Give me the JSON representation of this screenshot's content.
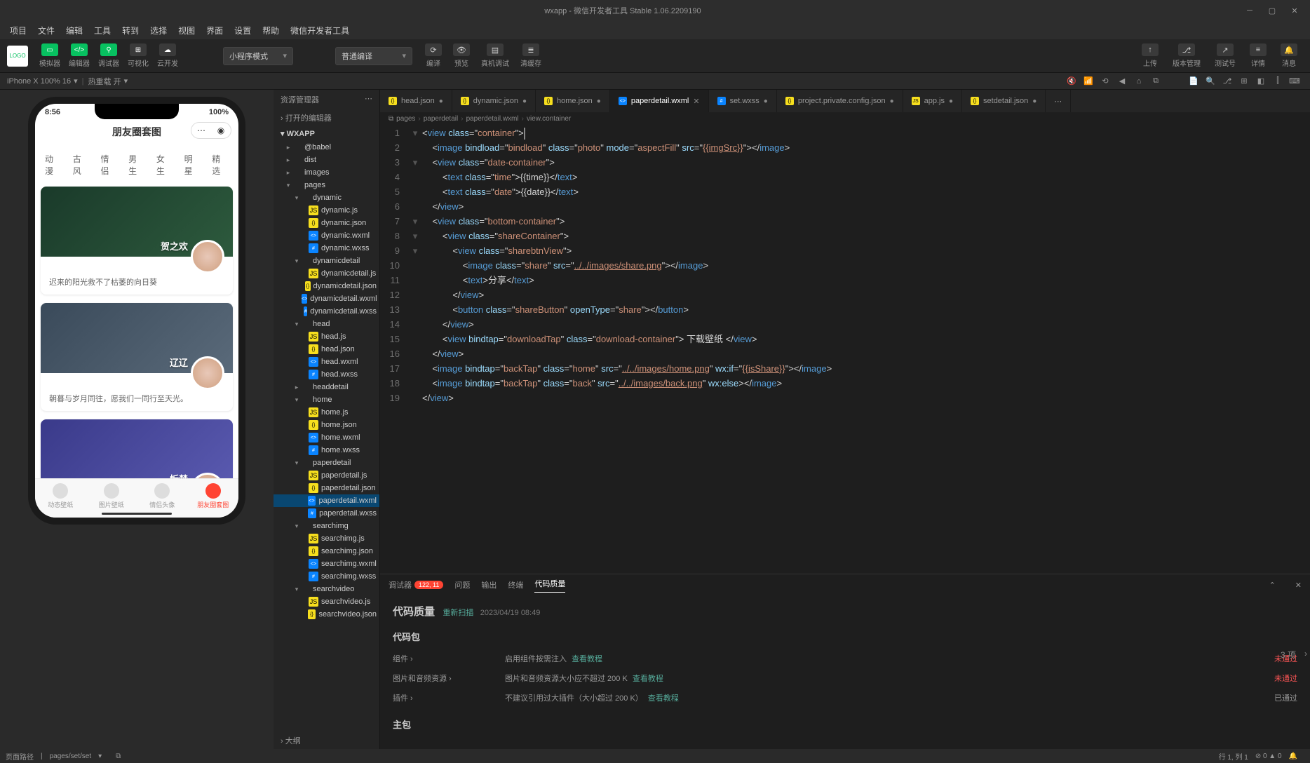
{
  "titlebar": {
    "title": "wxapp - 微信开发者工具 Stable 1.06.2209190"
  },
  "menu": {
    "items": [
      "项目",
      "文件",
      "编辑",
      "工具",
      "转到",
      "选择",
      "视图",
      "界面",
      "设置",
      "帮助",
      "微信开发者工具"
    ]
  },
  "toolbar": {
    "sim": "模拟器",
    "editor": "编辑器",
    "debug": "调试器",
    "visual": "可视化",
    "cloud": "云开发",
    "mode": "小程序模式",
    "compileMode": "普通编译",
    "compile": "编译",
    "preview": "预览",
    "remote": "真机调试",
    "clear": "清缓存",
    "upload": "上传",
    "version": "版本管理",
    "testnum": "测试号",
    "detail": "详情",
    "message": "消息"
  },
  "devicebar": {
    "device": "iPhone X 100% 16",
    "reload": "热重载 开"
  },
  "phone": {
    "time": "8:56",
    "battery": "100%",
    "title": "朋友圈套图",
    "tabs": [
      "动漫",
      "古风",
      "情侣",
      "男生",
      "女生",
      "明星",
      "精选"
    ],
    "card1": {
      "name": "贺之欢",
      "desc": "迟来的阳光救不了枯萎的向日葵"
    },
    "card2": {
      "name": "辽辽",
      "desc": "朝暮与岁月同往，愿我们一同行至天光。"
    },
    "card3": {
      "name": "忻楚"
    },
    "nav": [
      "动态壁纸",
      "图片壁纸",
      "情侣头像",
      "朋友圈套图"
    ]
  },
  "filetree": {
    "header": "资源管理器",
    "openeds": "› 打开的编辑器",
    "outline": "› 大纲",
    "root": "WXAPP",
    "nodes": [
      {
        "indent": 1,
        "name": "@babel",
        "type": "folder"
      },
      {
        "indent": 1,
        "name": "dist",
        "type": "folder"
      },
      {
        "indent": 1,
        "name": "images",
        "type": "folder"
      },
      {
        "indent": 1,
        "name": "pages",
        "type": "folder-open"
      },
      {
        "indent": 2,
        "name": "dynamic",
        "type": "folder-open"
      },
      {
        "indent": 3,
        "name": "dynamic.js",
        "type": "js"
      },
      {
        "indent": 3,
        "name": "dynamic.json",
        "type": "json"
      },
      {
        "indent": 3,
        "name": "dynamic.wxml",
        "type": "wxml"
      },
      {
        "indent": 3,
        "name": "dynamic.wxss",
        "type": "wxss"
      },
      {
        "indent": 2,
        "name": "dynamicdetail",
        "type": "folder-open"
      },
      {
        "indent": 3,
        "name": "dynamicdetail.js",
        "type": "js"
      },
      {
        "indent": 3,
        "name": "dynamicdetail.json",
        "type": "json"
      },
      {
        "indent": 3,
        "name": "dynamicdetail.wxml",
        "type": "wxml"
      },
      {
        "indent": 3,
        "name": "dynamicdetail.wxss",
        "type": "wxss"
      },
      {
        "indent": 2,
        "name": "head",
        "type": "folder-open"
      },
      {
        "indent": 3,
        "name": "head.js",
        "type": "js"
      },
      {
        "indent": 3,
        "name": "head.json",
        "type": "json"
      },
      {
        "indent": 3,
        "name": "head.wxml",
        "type": "wxml"
      },
      {
        "indent": 3,
        "name": "head.wxss",
        "type": "wxss"
      },
      {
        "indent": 2,
        "name": "headdetail",
        "type": "folder"
      },
      {
        "indent": 2,
        "name": "home",
        "type": "folder-open"
      },
      {
        "indent": 3,
        "name": "home.js",
        "type": "js"
      },
      {
        "indent": 3,
        "name": "home.json",
        "type": "json"
      },
      {
        "indent": 3,
        "name": "home.wxml",
        "type": "wxml"
      },
      {
        "indent": 3,
        "name": "home.wxss",
        "type": "wxss"
      },
      {
        "indent": 2,
        "name": "paperdetail",
        "type": "folder-open"
      },
      {
        "indent": 3,
        "name": "paperdetail.js",
        "type": "js"
      },
      {
        "indent": 3,
        "name": "paperdetail.json",
        "type": "json"
      },
      {
        "indent": 3,
        "name": "paperdetail.wxml",
        "type": "wxml",
        "sel": true
      },
      {
        "indent": 3,
        "name": "paperdetail.wxss",
        "type": "wxss"
      },
      {
        "indent": 2,
        "name": "searchimg",
        "type": "folder-open"
      },
      {
        "indent": 3,
        "name": "searchimg.js",
        "type": "js"
      },
      {
        "indent": 3,
        "name": "searchimg.json",
        "type": "json"
      },
      {
        "indent": 3,
        "name": "searchimg.wxml",
        "type": "wxml"
      },
      {
        "indent": 3,
        "name": "searchimg.wxss",
        "type": "wxss"
      },
      {
        "indent": 2,
        "name": "searchvideo",
        "type": "folder-open"
      },
      {
        "indent": 3,
        "name": "searchvideo.js",
        "type": "js"
      },
      {
        "indent": 3,
        "name": "searchvideo.json",
        "type": "json"
      }
    ]
  },
  "editorTabs": [
    {
      "name": "head.json",
      "icon": "json"
    },
    {
      "name": "dynamic.json",
      "icon": "json"
    },
    {
      "name": "home.json",
      "icon": "json"
    },
    {
      "name": "paperdetail.wxml",
      "icon": "wxml",
      "active": true,
      "close": true
    },
    {
      "name": "set.wxss",
      "icon": "wxss"
    },
    {
      "name": "project.private.config.json",
      "icon": "json"
    },
    {
      "name": "app.js",
      "icon": "js"
    },
    {
      "name": "setdetail.json",
      "icon": "json"
    }
  ],
  "breadcrumb": [
    "pages",
    "paperdetail",
    "paperdetail.wxml",
    "view.container"
  ],
  "code": [
    {
      "n": 1,
      "fold": "▾",
      "segs": [
        [
          "txt",
          "<"
        ],
        [
          "tag",
          "view"
        ],
        [
          "txt",
          " "
        ],
        [
          "attr",
          "class"
        ],
        [
          "txt",
          "=\""
        ],
        [
          "str",
          "container"
        ],
        [
          "txt",
          "\">"
        ]
      ],
      "cursor": true
    },
    {
      "n": 2,
      "segs": [
        [
          "txt",
          "    <"
        ],
        [
          "tag",
          "image"
        ],
        [
          "txt",
          " "
        ],
        [
          "attr",
          "bindload"
        ],
        [
          "txt",
          "=\""
        ],
        [
          "str",
          "bindload"
        ],
        [
          "txt",
          "\" "
        ],
        [
          "attr",
          "class"
        ],
        [
          "txt",
          "=\""
        ],
        [
          "str",
          "photo"
        ],
        [
          "txt",
          "\" "
        ],
        [
          "attr",
          "mode"
        ],
        [
          "txt",
          "=\""
        ],
        [
          "str",
          "aspectFill"
        ],
        [
          "txt",
          "\" "
        ],
        [
          "attr",
          "src"
        ],
        [
          "txt",
          "=\""
        ],
        [
          "bind",
          "{{imgSrc}}"
        ],
        [
          "txt",
          "\"></"
        ],
        [
          "tag",
          "image"
        ],
        [
          "txt",
          ">"
        ]
      ]
    },
    {
      "n": 3,
      "fold": "▾",
      "segs": [
        [
          "txt",
          "    <"
        ],
        [
          "tag",
          "view"
        ],
        [
          "txt",
          " "
        ],
        [
          "attr",
          "class"
        ],
        [
          "txt",
          "=\""
        ],
        [
          "str",
          "date-container"
        ],
        [
          "txt",
          "\">"
        ]
      ]
    },
    {
      "n": 4,
      "segs": [
        [
          "txt",
          "        <"
        ],
        [
          "tag",
          "text"
        ],
        [
          "txt",
          " "
        ],
        [
          "attr",
          "class"
        ],
        [
          "txt",
          "=\""
        ],
        [
          "str",
          "time"
        ],
        [
          "txt",
          "\">{{time}}</"
        ],
        [
          "tag",
          "text"
        ],
        [
          "txt",
          ">"
        ]
      ]
    },
    {
      "n": 5,
      "segs": [
        [
          "txt",
          "        <"
        ],
        [
          "tag",
          "text"
        ],
        [
          "txt",
          " "
        ],
        [
          "attr",
          "class"
        ],
        [
          "txt",
          "=\""
        ],
        [
          "str",
          "date"
        ],
        [
          "txt",
          "\">{{date}}</"
        ],
        [
          "tag",
          "text"
        ],
        [
          "txt",
          ">"
        ]
      ]
    },
    {
      "n": 6,
      "segs": [
        [
          "txt",
          "    </"
        ],
        [
          "tag",
          "view"
        ],
        [
          "txt",
          ">"
        ]
      ]
    },
    {
      "n": 7,
      "fold": "▾",
      "segs": [
        [
          "txt",
          "    <"
        ],
        [
          "tag",
          "view"
        ],
        [
          "txt",
          " "
        ],
        [
          "attr",
          "class"
        ],
        [
          "txt",
          "=\""
        ],
        [
          "str",
          "bottom-container"
        ],
        [
          "txt",
          "\">"
        ]
      ]
    },
    {
      "n": 8,
      "fold": "▾",
      "segs": [
        [
          "txt",
          "        <"
        ],
        [
          "tag",
          "view"
        ],
        [
          "txt",
          " "
        ],
        [
          "attr",
          "class"
        ],
        [
          "txt",
          "=\""
        ],
        [
          "str",
          "shareContainer"
        ],
        [
          "txt",
          "\">"
        ]
      ]
    },
    {
      "n": 9,
      "fold": "▾",
      "segs": [
        [
          "txt",
          "            <"
        ],
        [
          "tag",
          "view"
        ],
        [
          "txt",
          " "
        ],
        [
          "attr",
          "class"
        ],
        [
          "txt",
          "=\""
        ],
        [
          "str",
          "sharebtnView"
        ],
        [
          "txt",
          "\">"
        ]
      ]
    },
    {
      "n": 10,
      "segs": [
        [
          "txt",
          "                <"
        ],
        [
          "tag",
          "image"
        ],
        [
          "txt",
          " "
        ],
        [
          "attr",
          "class"
        ],
        [
          "txt",
          "=\""
        ],
        [
          "str",
          "share"
        ],
        [
          "txt",
          "\" "
        ],
        [
          "attr",
          "src"
        ],
        [
          "txt",
          "=\""
        ],
        [
          "bind",
          "../../images/share.png"
        ],
        [
          "txt",
          "\"></"
        ],
        [
          "tag",
          "image"
        ],
        [
          "txt",
          ">"
        ]
      ]
    },
    {
      "n": 11,
      "segs": [
        [
          "txt",
          "                <"
        ],
        [
          "tag",
          "text"
        ],
        [
          "txt",
          ">分享</"
        ],
        [
          "tag",
          "text"
        ],
        [
          "txt",
          ">"
        ]
      ]
    },
    {
      "n": 12,
      "segs": [
        [
          "txt",
          "            </"
        ],
        [
          "tag",
          "view"
        ],
        [
          "txt",
          ">"
        ]
      ]
    },
    {
      "n": 13,
      "segs": [
        [
          "txt",
          "            <"
        ],
        [
          "tag",
          "button"
        ],
        [
          "txt",
          " "
        ],
        [
          "attr",
          "class"
        ],
        [
          "txt",
          "=\""
        ],
        [
          "str",
          "shareButton"
        ],
        [
          "txt",
          "\" "
        ],
        [
          "attr",
          "openType"
        ],
        [
          "txt",
          "=\""
        ],
        [
          "str",
          "share"
        ],
        [
          "txt",
          "\"></"
        ],
        [
          "tag",
          "button"
        ],
        [
          "txt",
          ">"
        ]
      ]
    },
    {
      "n": 14,
      "segs": [
        [
          "txt",
          "        </"
        ],
        [
          "tag",
          "view"
        ],
        [
          "txt",
          ">"
        ]
      ]
    },
    {
      "n": 15,
      "segs": [
        [
          "txt",
          "        <"
        ],
        [
          "tag",
          "view"
        ],
        [
          "txt",
          " "
        ],
        [
          "attr",
          "bindtap"
        ],
        [
          "txt",
          "=\""
        ],
        [
          "str",
          "downloadTap"
        ],
        [
          "txt",
          "\" "
        ],
        [
          "attr",
          "class"
        ],
        [
          "txt",
          "=\""
        ],
        [
          "str",
          "download-container"
        ],
        [
          "txt",
          "\"> 下载壁纸 </"
        ],
        [
          "tag",
          "view"
        ],
        [
          "txt",
          ">"
        ]
      ]
    },
    {
      "n": 16,
      "segs": [
        [
          "txt",
          "    </"
        ],
        [
          "tag",
          "view"
        ],
        [
          "txt",
          ">"
        ]
      ]
    },
    {
      "n": 17,
      "segs": [
        [
          "txt",
          "    <"
        ],
        [
          "tag",
          "image"
        ],
        [
          "txt",
          " "
        ],
        [
          "attr",
          "bindtap"
        ],
        [
          "txt",
          "=\""
        ],
        [
          "str",
          "backTap"
        ],
        [
          "txt",
          "\" "
        ],
        [
          "attr",
          "class"
        ],
        [
          "txt",
          "=\""
        ],
        [
          "str",
          "home"
        ],
        [
          "txt",
          "\" "
        ],
        [
          "attr",
          "src"
        ],
        [
          "txt",
          "=\""
        ],
        [
          "bind",
          "../../images/home.png"
        ],
        [
          "txt",
          "\" "
        ],
        [
          "attr",
          "wx:if"
        ],
        [
          "txt",
          "=\""
        ],
        [
          "bind",
          "{{isShare}}"
        ],
        [
          "txt",
          "\"></"
        ],
        [
          "tag",
          "image"
        ],
        [
          "txt",
          ">"
        ]
      ]
    },
    {
      "n": 18,
      "segs": [
        [
          "txt",
          "    <"
        ],
        [
          "tag",
          "image"
        ],
        [
          "txt",
          " "
        ],
        [
          "attr",
          "bindtap"
        ],
        [
          "txt",
          "=\""
        ],
        [
          "str",
          "backTap"
        ],
        [
          "txt",
          "\" "
        ],
        [
          "attr",
          "class"
        ],
        [
          "txt",
          "=\""
        ],
        [
          "str",
          "back"
        ],
        [
          "txt",
          "\" "
        ],
        [
          "attr",
          "src"
        ],
        [
          "txt",
          "=\""
        ],
        [
          "bind",
          "../../images/back.png"
        ],
        [
          "txt",
          "\" "
        ],
        [
          "attr",
          "wx:else"
        ],
        [
          "txt",
          "></"
        ],
        [
          "tag",
          "image"
        ],
        [
          "txt",
          ">"
        ]
      ]
    },
    {
      "n": 19,
      "segs": [
        [
          "txt",
          "</"
        ],
        [
          "tag",
          "view"
        ],
        [
          "txt",
          ">"
        ]
      ]
    }
  ],
  "panel": {
    "tabs": {
      "debugger": "调试器",
      "badge": "122, 11",
      "problems": "问题",
      "output": "输出",
      "terminal": "终端",
      "quality": "代码质量"
    },
    "title": "代码质量",
    "rescan": "重新扫描",
    "timestamp": "2023/04/19 08:49",
    "pkg": "代码包",
    "count": "3 项",
    "rules": [
      {
        "label": "组件",
        "desc": "启用组件按需注入",
        "link": "查看教程",
        "status": "未通过"
      },
      {
        "label": "图片和音频资源",
        "desc": "图片和音频资源大小应不超过 200 K",
        "link": "查看教程",
        "status": "未通过"
      },
      {
        "label": "插件",
        "desc": "不建议引用过大插件（大小超过 200 K）",
        "link": "查看教程",
        "status": "已通过",
        "pass": true
      }
    ],
    "main": "主包"
  },
  "statusbar": {
    "path": "页面路径",
    "pathval": "pages/set/set",
    "pos": "行 1, 列 1",
    "errs": "⊘ 0 ▲ 0"
  }
}
